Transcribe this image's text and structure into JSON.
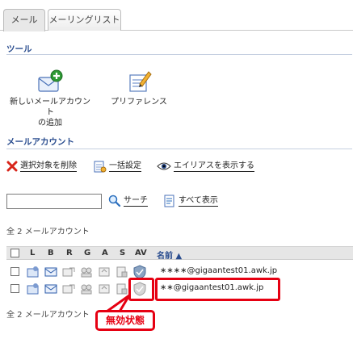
{
  "tabs": [
    {
      "label": "メール",
      "active": true
    },
    {
      "label": "メーリングリスト",
      "active": false
    }
  ],
  "tools": {
    "heading": "ツール",
    "items": [
      {
        "label_line1": "新しいメールアカウント",
        "label_line2": "の追加",
        "icon": "new-mail-account-icon"
      },
      {
        "label_line1": "プリファレンス",
        "icon": "preferences-icon"
      }
    ]
  },
  "accounts": {
    "heading": "メールアカウント",
    "actions": [
      {
        "label": "選択対象を削除",
        "icon": "delete-x-icon"
      },
      {
        "label": "一括設定",
        "icon": "bulk-settings-icon"
      },
      {
        "label": "エイリアスを表示する",
        "icon": "eye-icon"
      }
    ],
    "search": {
      "value": "",
      "button_label": "サーチ",
      "show_all_label": "すべて表示"
    },
    "total_top": "全 2 メールアカウント",
    "total_bottom": "全 2 メールアカウント",
    "columns": [
      "L",
      "B",
      "R",
      "G",
      "A",
      "S",
      "AV",
      "名前 ▲"
    ],
    "rows": [
      {
        "email": "∗∗∗∗@gigaantest01.awk.jp",
        "av_enabled": true,
        "selected": false
      },
      {
        "email": "∗∗@gigaantest01.awk.jp",
        "av_enabled": false,
        "selected": false
      }
    ]
  },
  "callout": {
    "label": "無効状態"
  },
  "colors": {
    "accent": "#2a4d8f",
    "highlight": "#e60012"
  }
}
